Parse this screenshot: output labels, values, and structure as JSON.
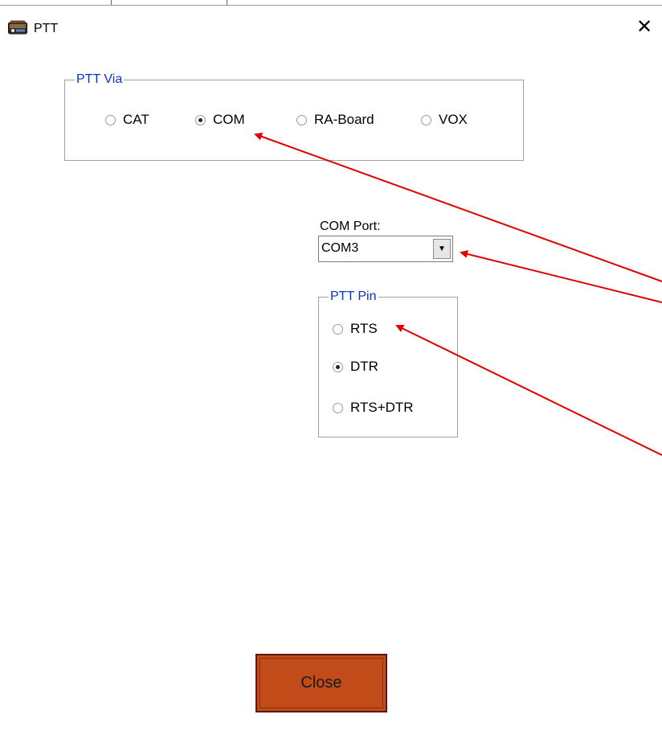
{
  "window": {
    "title": "PTT",
    "close_glyph": "✕"
  },
  "ptt_via": {
    "legend": "PTT Via",
    "options": [
      "CAT",
      "COM",
      "RA-Board",
      "VOX"
    ],
    "selected": "COM"
  },
  "com_port": {
    "label": "COM Port:",
    "value": "COM3"
  },
  "ptt_pin": {
    "legend": "PTT Pin",
    "options": [
      "RTS",
      "DTR",
      "RTS+DTR"
    ],
    "selected": "DTR"
  },
  "close_button": {
    "label": "Close"
  },
  "icons": {
    "app": "radio-app-icon",
    "close": "close-icon",
    "dropdown": "dropdown-arrow-icon"
  },
  "colors": {
    "legend_text": "#0a33c8",
    "annotation_arrow": "#e00000",
    "close_button_bg": "#c24b1a"
  }
}
